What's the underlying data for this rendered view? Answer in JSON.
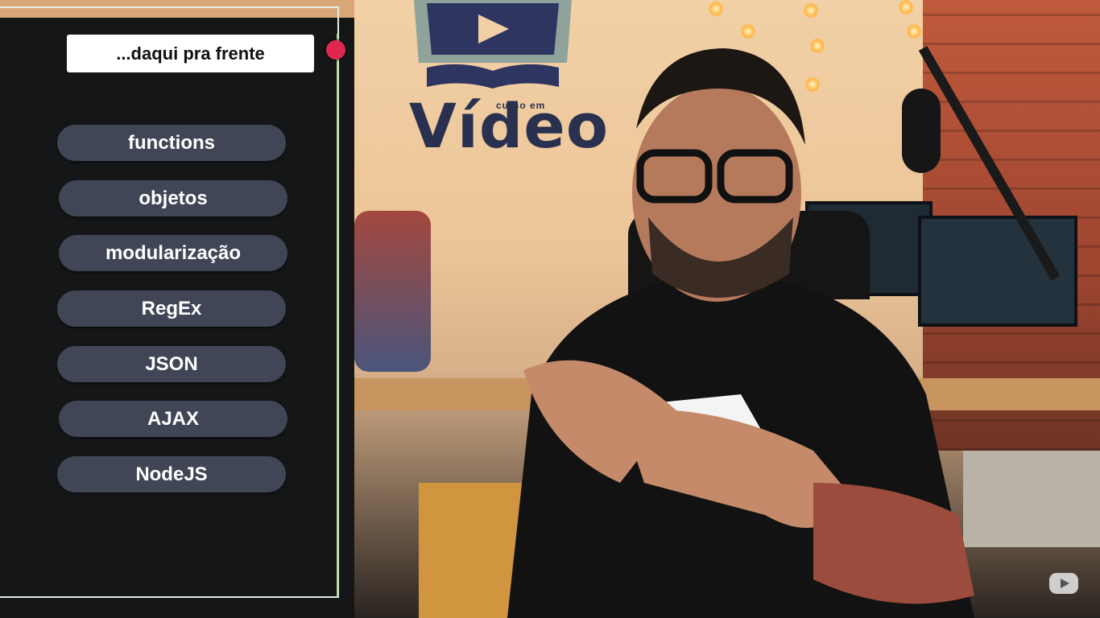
{
  "overlay": {
    "title": "...daqui pra frente",
    "topics": [
      {
        "label": "functions"
      },
      {
        "label": "objetos"
      },
      {
        "label": "modularização"
      },
      {
        "label": "RegEx"
      },
      {
        "label": "JSON"
      },
      {
        "label": "AJAX"
      },
      {
        "label": "NodeJS"
      }
    ],
    "record_indicator_color": "#e0274f",
    "pill_color": "#414657",
    "panel_color": "#141617"
  },
  "scene": {
    "logo_text": "Vídeo",
    "logo_tagline": "curso em"
  },
  "watermark": {
    "icon": "youtube-icon"
  }
}
